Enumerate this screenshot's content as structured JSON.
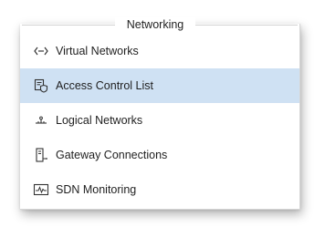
{
  "header": {
    "title": "Networking"
  },
  "nav": {
    "items": [
      {
        "label": "Virtual Networks",
        "icon": "virtual-network-icon",
        "selected": false
      },
      {
        "label": "Access Control List",
        "icon": "access-control-icon",
        "selected": true
      },
      {
        "label": "Logical Networks",
        "icon": "logical-network-icon",
        "selected": false
      },
      {
        "label": "Gateway Connections",
        "icon": "gateway-icon",
        "selected": false
      },
      {
        "label": "SDN Monitoring",
        "icon": "monitoring-icon",
        "selected": false
      }
    ]
  },
  "colors": {
    "selected_background": "#cfe1f3",
    "text": "#1f1f1f"
  }
}
